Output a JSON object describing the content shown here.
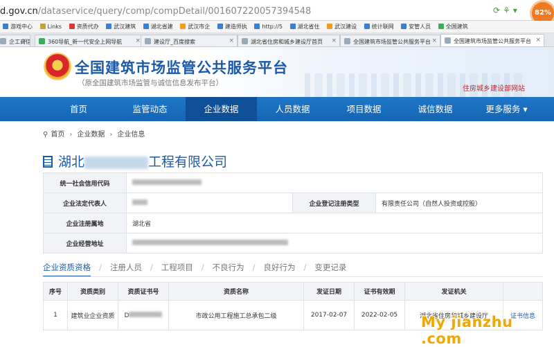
{
  "browser": {
    "url_host": "d.gov.cn",
    "url_path": "/dataservice/query/comp/compDetail/001607220057394548",
    "badge_percent": "82%",
    "bookmarks": [
      "游戏中心",
      "Links",
      "资质代办",
      "武汉建筑",
      "湖北省建",
      "武汉市企",
      "建造师执",
      "http://5",
      "湖北省住",
      "武汉建设",
      "统计联网",
      "安管人员",
      "全国建筑"
    ],
    "tabs": [
      {
        "label": "企工商信息"
      },
      {
        "label": "360导航_新一代安全上网导航"
      },
      {
        "label": "建设厅_百度搜索"
      },
      {
        "label": "湖北省住房和城乡建设厅首页"
      },
      {
        "label": "全国建筑市场监管公共服务平台"
      },
      {
        "label": "全国建筑市场监管公共服务平台"
      }
    ]
  },
  "header": {
    "title": "全国建筑市场监管公共服务平台",
    "subtitle": "（原全国建筑市场监管与诚信信息发布平台）",
    "mohurd": "住房城乡建设部网站"
  },
  "nav": {
    "items": [
      "首页",
      "监管动态",
      "企业数据",
      "人员数据",
      "项目数据",
      "诚信数据",
      "更多服务 ▾"
    ],
    "active_index": 2
  },
  "breadcrumb": [
    "首页",
    "企业数据",
    "企业信息"
  ],
  "company": {
    "name_prefix": "湖北",
    "name_suffix": "工程有限公司"
  },
  "info": {
    "credit_code_label": "统一社会信用代码",
    "legal_rep_label": "企业法定代表人",
    "reg_type_label": "企业登记注册类型",
    "reg_type_value": "有限责任公司（自然人投资或控股）",
    "reg_place_label": "企业注册属地",
    "reg_place_value": "湖北省",
    "address_label": "企业经营地址"
  },
  "subtabs": [
    "企业资质资格",
    "注册人员",
    "工程项目",
    "不良行为",
    "良好行为",
    "变更记录"
  ],
  "qual_table": {
    "headers": [
      "序号",
      "资质类别",
      "资质证书号",
      "资质名称",
      "发证日期",
      "证书有效期",
      "发证机关",
      ""
    ],
    "rows": [
      {
        "no": "1",
        "category": "建筑业企业资质",
        "cert_no": "D",
        "name": "市政公用工程施工总承包二级",
        "issue_date": "2017-02-07",
        "valid_until": "2022-02-05",
        "authority": "湖北省住房和城乡建设厅",
        "action": "证书信息"
      }
    ]
  },
  "watermark": "My jianzhu .com"
}
